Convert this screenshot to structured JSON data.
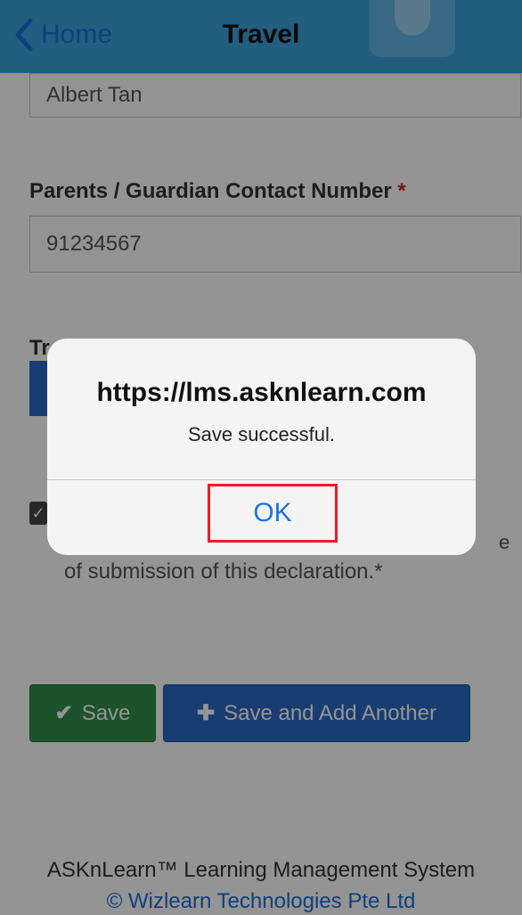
{
  "nav": {
    "back_label": "Home",
    "title": "Travel"
  },
  "form": {
    "name_value": "Albert Tan",
    "contact_label": "Parents / Guardian Contact Number",
    "required_mark": "*",
    "contact_value": "91234567",
    "transit_label_partial": "Tr",
    "declaration_tail": "e",
    "declaration_text": "of submission of this declaration.*",
    "checkbox_checked": true
  },
  "buttons": {
    "save": "Save",
    "save_add": "Save and Add Another"
  },
  "footer": {
    "line1": "ASKnLearn™ Learning Management System",
    "line2": "© Wizlearn Technologies Pte Ltd"
  },
  "dialog": {
    "title": "https://lms.asknlearn.com",
    "message": "Save successful.",
    "ok_label": "OK"
  },
  "colors": {
    "navbar": "#3aa3dc",
    "save_green": "#2f8f4a",
    "add_blue": "#2a6ac4",
    "highlight_red": "#e3202b",
    "link_blue": "#1a73e8"
  }
}
